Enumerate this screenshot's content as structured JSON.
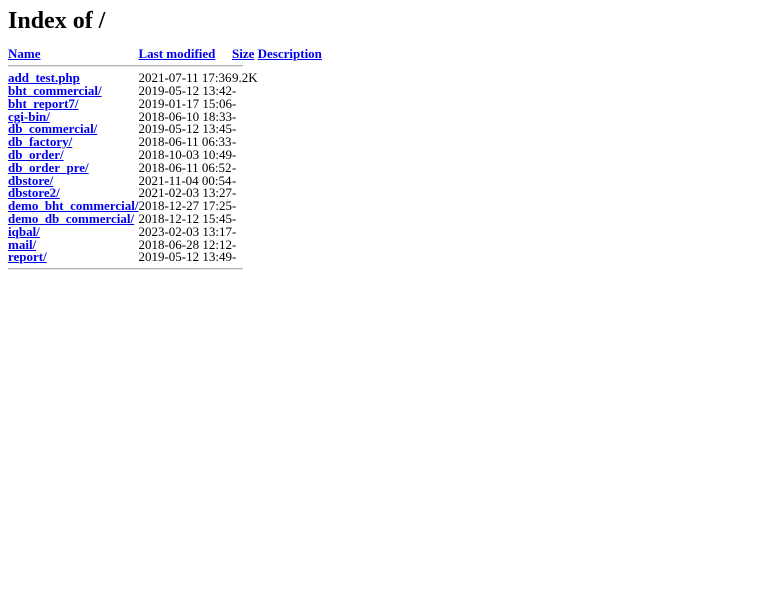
{
  "page": {
    "title": "Index of /"
  },
  "table": {
    "headers": [
      {
        "label": "Name",
        "name": "column-header-name"
      },
      {
        "label": "Last modified",
        "name": "column-header-last-modified"
      },
      {
        "label": "Size",
        "name": "column-header-size"
      },
      {
        "label": "Description",
        "name": "column-header-description"
      }
    ],
    "rows": [
      {
        "name": "add_test.php",
        "last_modified": "2021-07-11 17:36",
        "size": "9.2K",
        "description": ""
      },
      {
        "name": "bht_commercial/",
        "last_modified": "2019-05-12 13:42",
        "size": "-",
        "description": ""
      },
      {
        "name": "bht_report7/",
        "last_modified": "2019-01-17 15:06",
        "size": "-",
        "description": ""
      },
      {
        "name": "cgi-bin/",
        "last_modified": "2018-06-10 18:33",
        "size": "-",
        "description": ""
      },
      {
        "name": "db_commercial/",
        "last_modified": "2019-05-12 13:45",
        "size": "-",
        "description": ""
      },
      {
        "name": "db_factory/",
        "last_modified": "2018-06-11 06:33",
        "size": "-",
        "description": ""
      },
      {
        "name": "db_order/",
        "last_modified": "2018-10-03 10:49",
        "size": "-",
        "description": ""
      },
      {
        "name": "db_order_pre/",
        "last_modified": "2018-06-11 06:52",
        "size": "-",
        "description": ""
      },
      {
        "name": "dbstore/",
        "last_modified": "2021-11-04 00:54",
        "size": "-",
        "description": ""
      },
      {
        "name": "dbstore2/",
        "last_modified": "2021-02-03 13:27",
        "size": "-",
        "description": ""
      },
      {
        "name": "demo_bht_commercial/",
        "last_modified": "2018-12-27 17:25",
        "size": "-",
        "description": ""
      },
      {
        "name": "demo_db_commercial/",
        "last_modified": "2018-12-12 15:45",
        "size": "-",
        "description": ""
      },
      {
        "name": "iqbal/",
        "last_modified": "2023-02-03 13:17",
        "size": "-",
        "description": ""
      },
      {
        "name": "mail/",
        "last_modified": "2018-06-28 12:12",
        "size": "-",
        "description": ""
      },
      {
        "name": "report/",
        "last_modified": "2019-05-12 13:49",
        "size": "-",
        "description": ""
      }
    ]
  },
  "colors": {
    "link": "#0000EE",
    "text": "#000000",
    "background": "#FFFFFF",
    "rule": "#B0B0B0"
  }
}
